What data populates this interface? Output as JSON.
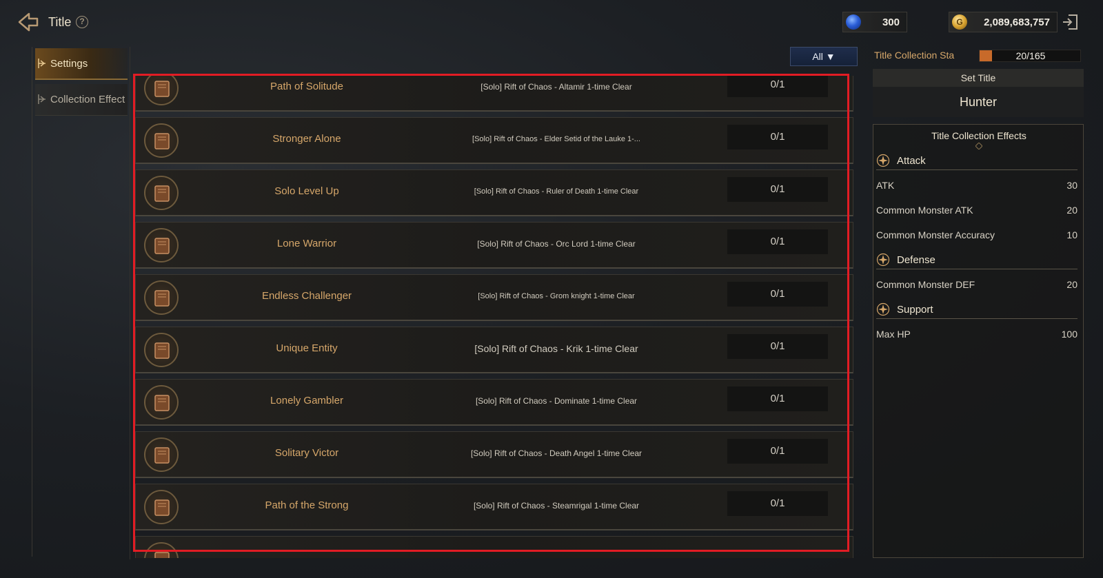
{
  "header": {
    "title": "Title",
    "help_symbol": "?",
    "back_icon": "back-arrow-icon",
    "exit_icon": "exit-icon",
    "currencies": [
      {
        "icon": "blue-gem-icon",
        "value": "300"
      },
      {
        "icon": "gold-coin-icon",
        "value": "2,089,683,757"
      }
    ]
  },
  "nav": {
    "tabs": [
      {
        "label": "Settings",
        "active": true
      },
      {
        "label": "Collection Effect",
        "active": false
      }
    ]
  },
  "filter": {
    "label": "All",
    "symbol": "▼"
  },
  "titles": [
    {
      "name": "Path of Solitude",
      "condition": "[Solo] Rift of Chaos - Altamir 1-time Clear",
      "progress": "0/1"
    },
    {
      "name": "Stronger Alone",
      "condition": "[Solo] Rift of Chaos - Elder Setid of the Lauke 1-...",
      "progress": "0/1"
    },
    {
      "name": "Solo Level Up",
      "condition": "[Solo] Rift of Chaos - Ruler of Death 1-time Clear",
      "progress": "0/1"
    },
    {
      "name": "Lone Warrior",
      "condition": "[Solo] Rift of Chaos - Orc Lord 1-time Clear",
      "progress": "0/1"
    },
    {
      "name": "Endless Challenger",
      "condition": "[Solo] Rift of Chaos - Grom knight 1-time Clear",
      "progress": "0/1"
    },
    {
      "name": "Unique Entity",
      "condition": "[Solo] Rift of Chaos - Krik 1-time Clear",
      "progress": "0/1"
    },
    {
      "name": "Lonely Gambler",
      "condition": "[Solo] Rift of Chaos - Dominate 1-time Clear",
      "progress": "0/1"
    },
    {
      "name": "Solitary Victor",
      "condition": "[Solo] Rift of Chaos - Death Angel 1-time Clear",
      "progress": "0/1"
    },
    {
      "name": "Path of the Strong",
      "condition": "[Solo] Rift of Chaos - Steamrigal 1-time Clear",
      "progress": "0/1"
    }
  ],
  "collection": {
    "label": "Title Collection Sta",
    "value": "20/165",
    "fraction": 0.121
  },
  "set_title": {
    "header": "Set Title",
    "current": "Hunter"
  },
  "effects": {
    "title": "Title Collection Effects",
    "groups": [
      {
        "name": "Attack",
        "items": [
          {
            "name": "ATK",
            "value": "30"
          },
          {
            "name": "Common Monster ATK",
            "value": "20"
          },
          {
            "name": "Common Monster Accuracy",
            "value": "10"
          }
        ]
      },
      {
        "name": "Defense",
        "items": [
          {
            "name": "Common Monster DEF",
            "value": "20"
          }
        ]
      },
      {
        "name": "Support",
        "items": [
          {
            "name": "Max HP",
            "value": "100"
          }
        ]
      }
    ]
  },
  "colors": {
    "accent_gold": "#d6a76a",
    "highlight": "#e21c24",
    "filter_blue": "#1f2d4b"
  }
}
